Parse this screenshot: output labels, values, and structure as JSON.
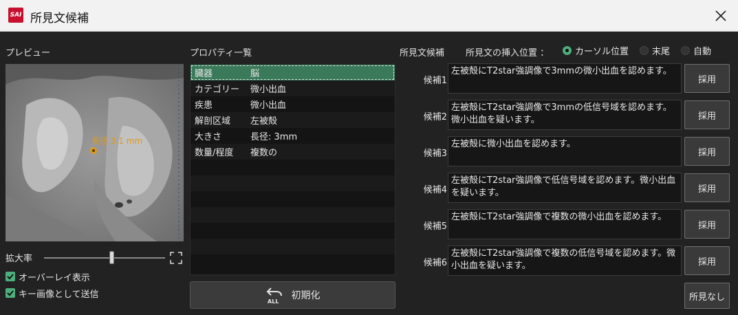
{
  "window": {
    "logo_text": "SAI",
    "title": "所見文候補"
  },
  "preview": {
    "label": "プレビュー",
    "measure_text": "長径 3.1 mm",
    "zoom_label": "拡大率",
    "zoom_level": 0.56,
    "overlay_label": "オーバーレイ表示",
    "send_key_label": "キー画像として送信"
  },
  "properties": {
    "label": "プロパティ一覧",
    "rows": [
      {
        "key": "臓器",
        "value": "脳"
      },
      {
        "key": "カテゴリー",
        "value": "微小出血"
      },
      {
        "key": "疾患",
        "value": "微小出血"
      },
      {
        "key": "解剖区域",
        "value": "左被殻"
      },
      {
        "key": "大きさ",
        "value": "長径: 3mm"
      },
      {
        "key": "数量/程度",
        "value": "複数の"
      }
    ],
    "reset_label": "初期化",
    "reset_icon_text": "ALL"
  },
  "candidates": {
    "label": "所見文候補",
    "insert_label": "所見文の挿入位置 ：",
    "insert_options": [
      "カーソル位置",
      "末尾",
      "自動"
    ],
    "items": [
      {
        "label": "候補1",
        "text": "左被殻にT2star強調像で3mmの微小出血を認めます。",
        "button": "採用"
      },
      {
        "label": "候補2",
        "text": "左被殻にT2star強調像で3mmの低信号域を認めます。微小出血を疑います。",
        "button": "採用"
      },
      {
        "label": "候補3",
        "text": "左被殻に微小出血を認めます。",
        "button": "採用"
      },
      {
        "label": "候補4",
        "text": "左被殻にT2star強調像で低信号域を認めます。微小出血を疑います。",
        "button": "採用"
      },
      {
        "label": "候補5",
        "text": "左被殻にT2star強調像で複数の微小出血を認めます。",
        "button": "採用"
      },
      {
        "label": "候補6",
        "text": "左被殻にT2star強調像で複数の低信号域を認めます。微小出血を疑います。",
        "button": "採用"
      }
    ],
    "no_finding_label": "所見なし"
  },
  "colors": {
    "accent": "#4caf7d",
    "selected_row": "#3a7a5a",
    "measure": "#e09a1a"
  }
}
